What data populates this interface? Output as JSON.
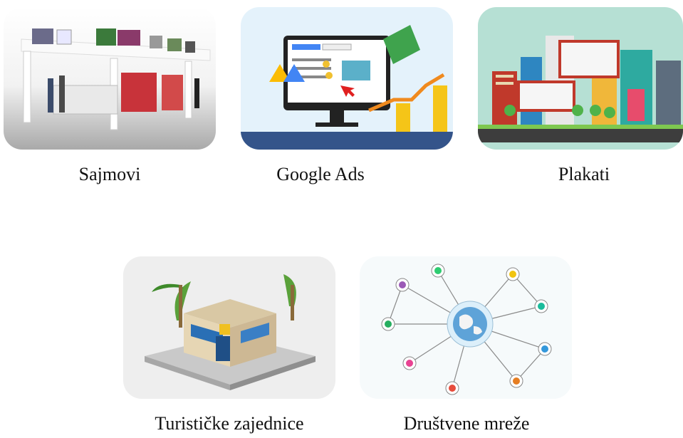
{
  "items": [
    {
      "label": "Sajmovi",
      "icon": "trade-fair-booth-image"
    },
    {
      "label": "Google Ads",
      "icon": "google-ads-monitor-image"
    },
    {
      "label": "Plakati",
      "icon": "city-billboards-image"
    },
    {
      "label": "Turističke zajednice",
      "icon": "tourist-info-office-image"
    },
    {
      "label": "Društvene mreže",
      "icon": "social-network-globe-image"
    }
  ]
}
